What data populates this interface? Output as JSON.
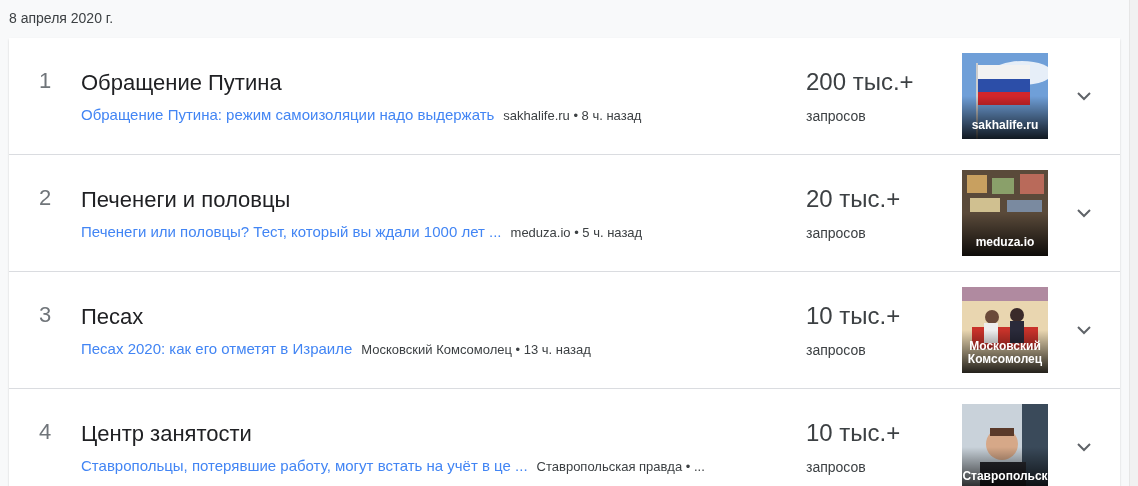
{
  "date": "8 апреля 2020 г.",
  "items": [
    {
      "rank": "1",
      "title": "Обращение Путина",
      "article": "Обращение Путина: режим самоизоляции надо выдержать",
      "meta": "sakhalife.ru • 8 ч. назад",
      "count": "200 тыс.+",
      "count_label": "запросов",
      "thumb_caption": "sakhalife.ru",
      "expanded": false
    },
    {
      "rank": "2",
      "title": "Печенеги и половцы",
      "article": "Печенеги или половцы? Тест, который вы ждали 1000 лет ...",
      "meta": "meduza.io • 5 ч. назад",
      "count": "20 тыс.+",
      "count_label": "запросов",
      "thumb_caption": "meduza.io",
      "expanded": false
    },
    {
      "rank": "3",
      "title": "Песах",
      "article": "Песах 2020: как его отметят в Израиле",
      "meta": "Московский Комсомолец • 13 ч. назад",
      "count": "10 тыс.+",
      "count_label": "запросов",
      "thumb_caption": "Московский Комсомолец",
      "expanded": false
    },
    {
      "rank": "4",
      "title": "Центр занятости",
      "article": "Ставропольцы, потерявшие работу, могут встать на учёт в це ...",
      "meta": "Ставропольская правда • ...",
      "count": "10 тыс.+",
      "count_label": "запросов",
      "thumb_caption": "Ставропольск",
      "expanded": false
    }
  ]
}
